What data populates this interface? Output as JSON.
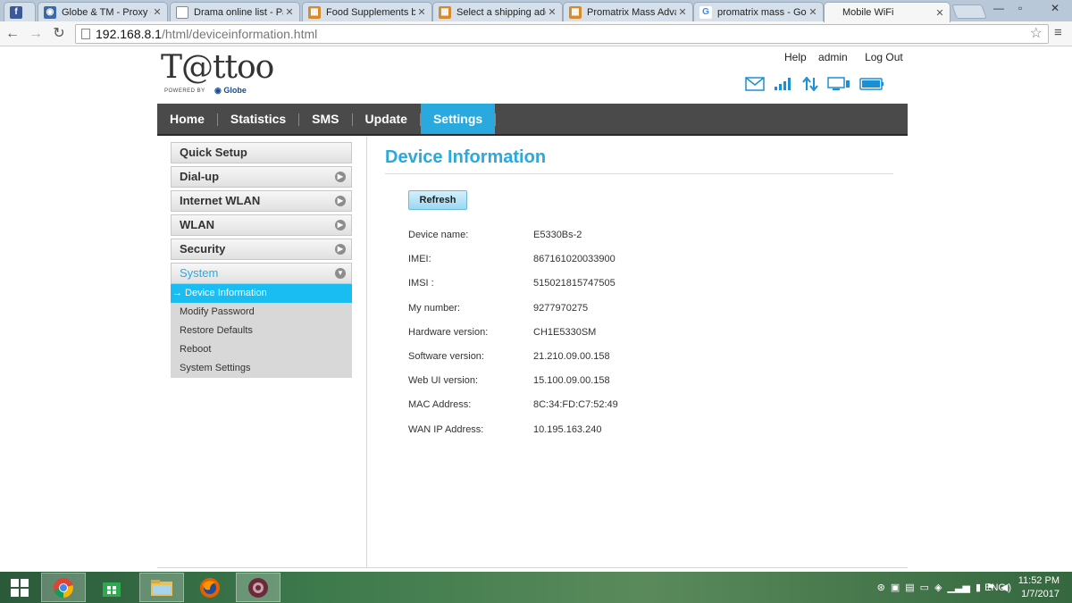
{
  "browser": {
    "tabs": [
      {
        "title": "",
        "icon": "facebook-icon",
        "color": "#3b5998",
        "glyph": "f"
      },
      {
        "title": "Globe & TM - Proxy c",
        "icon": "forum-icon",
        "color": "#3c6aa8",
        "glyph": "◉"
      },
      {
        "title": "Drama online list - Pa",
        "icon": "page-icon",
        "color": "#8899aa",
        "glyph": ""
      },
      {
        "title": "Food Supplements b",
        "icon": "shop-icon",
        "color": "#d88a2a",
        "glyph": "▦"
      },
      {
        "title": "Select a shipping add",
        "icon": "shop-icon",
        "color": "#d88a2a",
        "glyph": "▦"
      },
      {
        "title": "Promatrix Mass Adva",
        "icon": "shop-icon",
        "color": "#d88a2a",
        "glyph": "▦"
      },
      {
        "title": "promatrix mass - Goo",
        "icon": "google-icon",
        "color": "#4285f4",
        "glyph": "G"
      },
      {
        "title": "Mobile WiFi",
        "icon": "",
        "color": "",
        "glyph": ""
      }
    ],
    "url_host": "192.168.8.1",
    "url_path": "/html/deviceinformation.html"
  },
  "header": {
    "logo_text": "T@ttoo",
    "logo_powered": "POWERED BY",
    "logo_brand": "Globe",
    "links": {
      "help": "Help",
      "user": "admin",
      "logout": "Log Out"
    }
  },
  "nav": {
    "home": "Home",
    "statistics": "Statistics",
    "sms": "SMS",
    "update": "Update",
    "settings": "Settings"
  },
  "sidebar": {
    "items": [
      {
        "label": "Quick Setup"
      },
      {
        "label": "Dial-up"
      },
      {
        "label": "Internet WLAN"
      },
      {
        "label": "WLAN"
      },
      {
        "label": "Security"
      },
      {
        "label": "System"
      }
    ],
    "system_sub": [
      {
        "label": "→ Device Information"
      },
      {
        "label": "Modify Password"
      },
      {
        "label": "Restore Defaults"
      },
      {
        "label": "Reboot"
      },
      {
        "label": "System Settings"
      }
    ]
  },
  "content": {
    "title": "Device Information",
    "refresh": "Refresh",
    "rows": [
      {
        "label": "Device name:",
        "value": "E5330Bs-2"
      },
      {
        "label": "IMEI:",
        "value": "867161020033900"
      },
      {
        "label": "IMSI :",
        "value": "515021815747505"
      },
      {
        "label": "My number:",
        "value": "9277970275"
      },
      {
        "label": "Hardware version:",
        "value": "CH1E5330SM"
      },
      {
        "label": "Software version:",
        "value": "21.210.09.00.158"
      },
      {
        "label": "Web UI version:",
        "value": "15.100.09.00.158"
      },
      {
        "label": "MAC Address:",
        "value": "8C:34:FD:C7:52:49"
      },
      {
        "label": "WAN IP Address:",
        "value": "10.195.163.240"
      }
    ]
  },
  "taskbar": {
    "lang": "ENG",
    "time": "11:52 PM",
    "date": "1/7/2017"
  },
  "colors": {
    "accent": "#2aa9df",
    "nav_bg": "#4a4a4a"
  }
}
